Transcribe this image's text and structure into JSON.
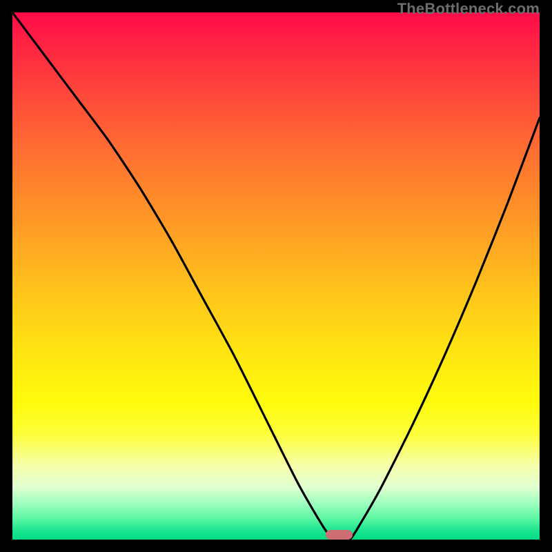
{
  "watermark": "TheBottleneck.com",
  "colors": {
    "frame": "#000000",
    "marker": "#cc6e74",
    "curve": "#000000"
  },
  "chart_data": {
    "type": "line",
    "title": "",
    "xlabel": "",
    "ylabel": "",
    "xlim": [
      0,
      100
    ],
    "ylim": [
      0,
      100
    ],
    "grid": false,
    "legend": false,
    "series": [
      {
        "name": "bottleneck-curve",
        "x": [
          0,
          6,
          12,
          18,
          24,
          30,
          36,
          42,
          48,
          54,
          58,
          60,
          62,
          64,
          66,
          70,
          76,
          82,
          88,
          94,
          100
        ],
        "values": [
          100,
          92,
          84,
          76,
          67,
          57,
          46,
          35,
          23,
          11,
          4,
          1,
          0,
          0,
          3,
          10,
          22,
          35,
          49,
          64,
          80
        ]
      }
    ],
    "marker": {
      "x_start": 60,
      "x_end": 64,
      "y": 0
    },
    "background_gradient_stops": [
      {
        "pct": 0,
        "color": "#ff0b48"
      },
      {
        "pct": 16,
        "color": "#ff4a3a"
      },
      {
        "pct": 40,
        "color": "#ff9a26"
      },
      {
        "pct": 64,
        "color": "#ffe412"
      },
      {
        "pct": 86,
        "color": "#f7ffac"
      },
      {
        "pct": 96,
        "color": "#5cf7a2"
      },
      {
        "pct": 100,
        "color": "#01db84"
      }
    ]
  }
}
